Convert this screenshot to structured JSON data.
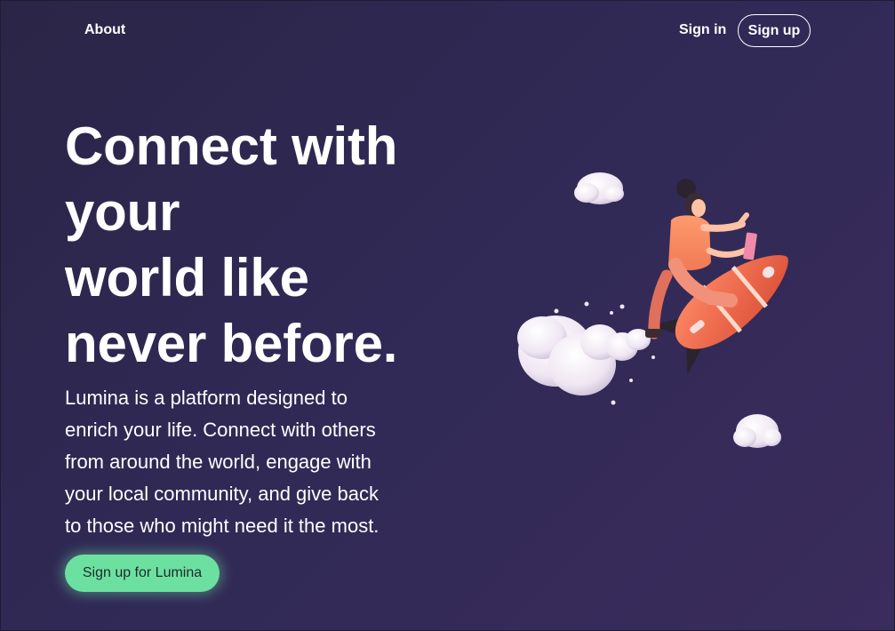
{
  "nav": {
    "about_label": "About",
    "signin_label": "Sign in",
    "signup_label": "Sign up"
  },
  "hero": {
    "title_lines": [
      "Connect with",
      "your",
      "world like",
      "never before."
    ],
    "description_lines": [
      "Lumina is a platform designed to",
      "enrich your life. Connect with others",
      "from around the world, engage with",
      "your local community, and give back",
      "to those who might need it the most."
    ],
    "cta_label": "Sign up for Lumina"
  },
  "colors": {
    "background": "#2e2850",
    "cta": "#6ce0a0",
    "rocket": "#ee6a4c",
    "cloud": "#f3eef6"
  }
}
